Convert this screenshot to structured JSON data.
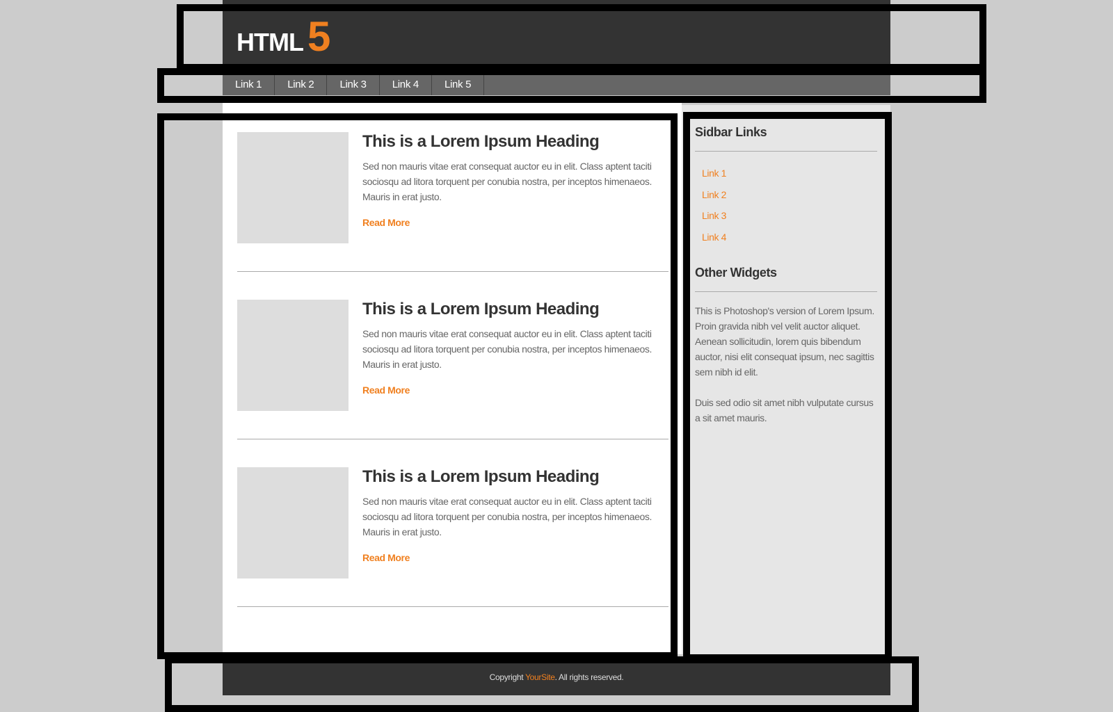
{
  "header": {
    "logo_text": "HTML",
    "logo_accent": "5"
  },
  "nav": {
    "items": [
      "Link 1",
      "Link 2",
      "Link 3",
      "Link 4",
      "Link 5"
    ]
  },
  "articles": [
    {
      "heading": "This is a Lorem Ipsum  Heading",
      "text": "Sed non  mauris vitae erat consequat auctor eu in elit. Class aptent taciti sociosqu ad litora torquent per conubia nostra, per inceptos himenaeos. Mauris in erat justo.",
      "read_more": "Read More"
    },
    {
      "heading": "This is a Lorem Ipsum  Heading",
      "text": "Sed non  mauris vitae erat consequat auctor eu in elit. Class aptent taciti sociosqu ad litora torquent per conubia nostra, per inceptos himenaeos. Mauris in erat justo.",
      "read_more": "Read More"
    },
    {
      "heading": "This is a Lorem Ipsum  Heading",
      "text": "Sed non  mauris vitae erat consequat auctor eu in elit. Class aptent taciti sociosqu ad litora torquent per conubia nostra, per inceptos himenaeos. Mauris in erat justo.",
      "read_more": "Read More"
    }
  ],
  "sidebar": {
    "links_heading": "Sidbar Links",
    "links": [
      "Link 1",
      "Link 2",
      "Link 3",
      "Link 4"
    ],
    "widgets_heading": "Other Widgets",
    "widget_text_1": "This is Photoshop's version  of Lorem Ipsum. Proin gravida nibh vel velit auctor aliquet. Aenean sollicitudin, lorem quis bibendum auctor, nisi elit consequat ipsum, nec sagittis sem nibh id elit.",
    "widget_text_2": "Duis sed odio sit amet nibh vulputate cursus a sit amet mauris."
  },
  "footer": {
    "prefix": "Copyright ",
    "site": "YourSite",
    "suffix": ". All rights reserved."
  },
  "colors": {
    "accent": "#f08020",
    "header_bg": "#333333",
    "nav_bg": "#666666",
    "page_bg": "#cccccc"
  }
}
